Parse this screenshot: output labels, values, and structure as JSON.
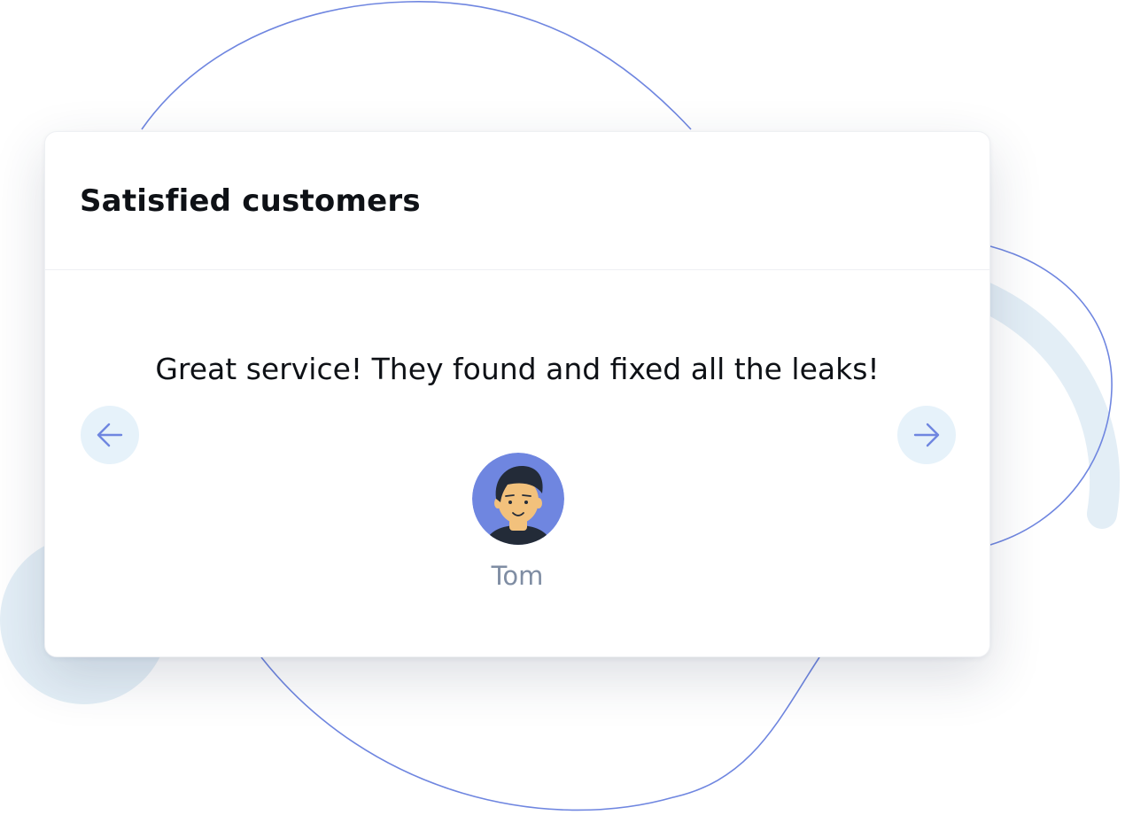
{
  "widget": {
    "title": "Satisfied customers",
    "testimonial": {
      "quote": "Great service! They found and fixed all the leaks!",
      "author": "Tom"
    },
    "prev_icon": "arrow-left-icon",
    "next_icon": "arrow-right-icon",
    "avatar_icon": "man-avatar-icon"
  },
  "colors": {
    "accent": "#6f86e0",
    "button_bg": "#e6f2fa",
    "decor_blob": "#e3eef6",
    "title_text": "#0e1116",
    "author_text": "#7f8da3"
  }
}
